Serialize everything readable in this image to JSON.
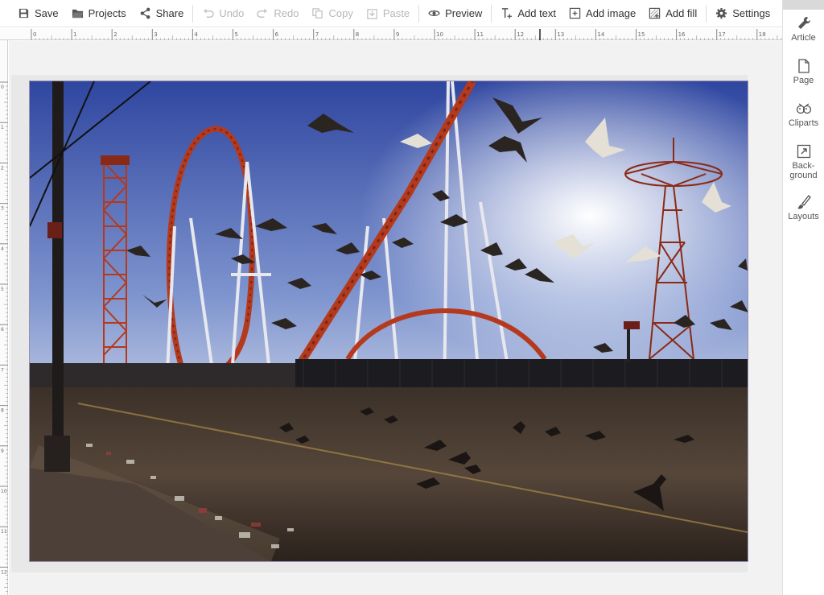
{
  "toolbar": {
    "save": "Save",
    "projects": "Projects",
    "share": "Share",
    "undo": "Undo",
    "redo": "Redo",
    "copy": "Copy",
    "paste": "Paste",
    "preview": "Preview",
    "add_text": "Add text",
    "add_image": "Add image",
    "add_fill": "Add fill",
    "settings": "Settings"
  },
  "sidebar": {
    "article": "Article",
    "page": "Page",
    "cliparts": "Cliparts",
    "background_1": "Back-",
    "background_2": "ground",
    "layouts": "Layouts"
  },
  "ruler": {
    "horizontal_labels": [
      "0",
      "1",
      "2",
      "3",
      "4",
      "5",
      "6",
      "7",
      "8",
      "9",
      "10",
      "11",
      "12",
      "13",
      "14",
      "15",
      "16",
      "17",
      "18"
    ],
    "vertical_labels": [
      "0",
      "1",
      "2",
      "3",
      "4",
      "5",
      "6",
      "7",
      "8",
      "9",
      "10",
      "11",
      "12"
    ]
  },
  "colors": {
    "toolbar_text": "#333333",
    "disabled_text": "#b7b7b7",
    "sky_top": "#3a4fa8",
    "sky_bottom": "#c9d3e8",
    "coaster_red": "#b5391c"
  },
  "photo": {
    "subject": "amusement park roller coasters with seagulls"
  }
}
